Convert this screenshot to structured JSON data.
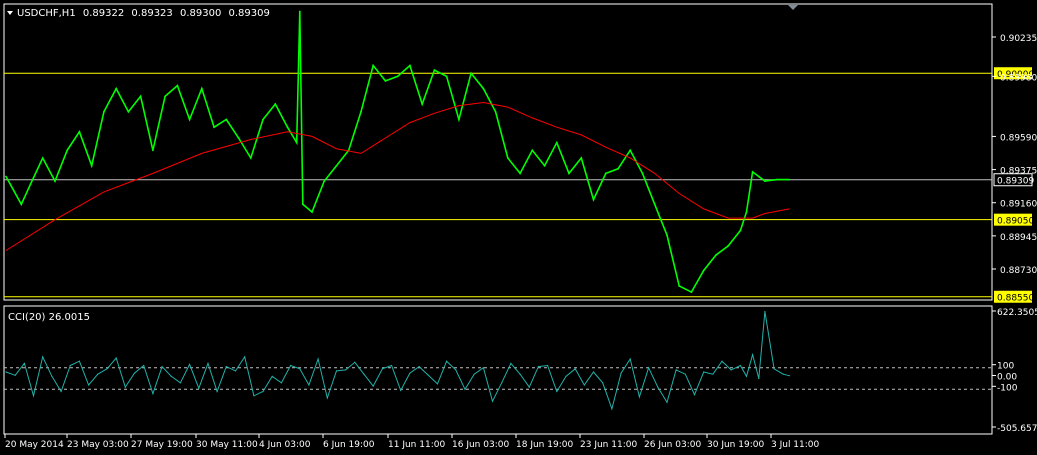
{
  "main_header": {
    "symbol": "USDCHF,H1",
    "open": "0.89322",
    "high": "0.89323",
    "low": "0.89300",
    "close": "0.89309"
  },
  "indicator_header": "CCI(20) 26.0015",
  "colors": {
    "background": "#000000",
    "frame": "#ffffff",
    "price_line": "#00ff00",
    "moving_average": "#ff0000",
    "level_line": "#ffff00",
    "level_label_bg": "#ffff00",
    "current_price_line": "#c0c0c0",
    "cci_line": "#20b2aa",
    "text": "#ffffff"
  },
  "chart_data": [
    {
      "type": "line",
      "title": "USDCHF,H1",
      "ylim": [
        0.8853,
        0.9042
      ],
      "y_ticks": [
        0.90235,
        0.8998,
        0.8959,
        0.89375,
        0.8916,
        0.88945,
        0.8873
      ],
      "y_tick_labels": [
        "0.90235",
        "0.89980",
        "0.89590",
        "0.89375",
        "0.89160",
        "0.88945",
        "0.88730"
      ],
      "x_ticks": [
        0,
        20,
        40,
        64,
        83,
        103,
        123,
        145,
        163,
        182,
        200,
        220,
        240,
        257
      ],
      "x_tick_labels": [
        "20 May 2014",
        "23 May 03:00",
        "27 May 19:00",
        "30 May 11:00",
        "4 Jun 03:00",
        "6 Jun 19:00",
        "11 Jun 11:00",
        "16 Jun 03:00",
        "18 Jun 19:00",
        "23 Jun 11:00",
        "26 Jun 03:00",
        "30 Jun 19:00",
        "3 Jul 11:00",
        ""
      ],
      "horizontal_levels": [
        {
          "value": 0.9,
          "label": "0.90000"
        },
        {
          "value": 0.8905,
          "label": "0.89050"
        },
        {
          "value": 0.8855,
          "label": "0.88550"
        }
      ],
      "current_price": {
        "value": 0.89309,
        "label": "0.89309"
      },
      "series": [
        {
          "name": "",
          "role": "close",
          "x": [
            0,
            5,
            8,
            12,
            16,
            20,
            24,
            28,
            32,
            36,
            40,
            44,
            48,
            52,
            56,
            60,
            64,
            68,
            72,
            76,
            80,
            84,
            88,
            92,
            95,
            96,
            97,
            100,
            104,
            108,
            112,
            116,
            120,
            124,
            128,
            132,
            136,
            140,
            144,
            148,
            152,
            156,
            160,
            164,
            168,
            172,
            176,
            180,
            184,
            188,
            192,
            196,
            200,
            204,
            208,
            212,
            216,
            220,
            224,
            228,
            232,
            236,
            240,
            242,
            244,
            246,
            248,
            252,
            256
          ],
          "values": [
            0.8933,
            0.8915,
            0.8928,
            0.8945,
            0.893,
            0.895,
            0.8962,
            0.894,
            0.8975,
            0.899,
            0.8975,
            0.8985,
            0.895,
            0.8985,
            0.8992,
            0.897,
            0.899,
            0.8965,
            0.897,
            0.8958,
            0.8945,
            0.897,
            0.898,
            0.8965,
            0.8955,
            0.904,
            0.8915,
            0.891,
            0.893,
            0.894,
            0.895,
            0.8975,
            0.9005,
            0.8995,
            0.8998,
            0.9005,
            0.898,
            0.9002,
            0.8998,
            0.897,
            0.9,
            0.899,
            0.8975,
            0.8945,
            0.8935,
            0.895,
            0.894,
            0.8955,
            0.8935,
            0.8945,
            0.8918,
            0.8935,
            0.8938,
            0.895,
            0.8935,
            0.8915,
            0.8895,
            0.8862,
            0.8858,
            0.8872,
            0.8882,
            0.8888,
            0.8898,
            0.891,
            0.8936,
            0.8933,
            0.893,
            0.8931,
            0.8931
          ]
        },
        {
          "name": "",
          "role": "moving-average",
          "x": [
            0,
            16,
            32,
            48,
            64,
            80,
            92,
            100,
            108,
            116,
            124,
            132,
            140,
            148,
            156,
            164,
            172,
            180,
            188,
            196,
            204,
            212,
            220,
            228,
            236,
            244,
            248,
            256
          ],
          "values": [
            0.8885,
            0.8905,
            0.8923,
            0.8935,
            0.8948,
            0.8957,
            0.8962,
            0.8959,
            0.8951,
            0.8948,
            0.8958,
            0.8968,
            0.8974,
            0.8979,
            0.8981,
            0.8978,
            0.8971,
            0.8965,
            0.896,
            0.8952,
            0.8945,
            0.8935,
            0.8922,
            0.8912,
            0.8906,
            0.8906,
            0.8909,
            0.8912
          ]
        }
      ]
    },
    {
      "type": "line",
      "title": "CCI(20) 26.0015",
      "ylim": [
        -505.6573,
        622.3505
      ],
      "y_ticks": [
        622.3505,
        100,
        0,
        -100,
        -505.6573
      ],
      "y_tick_labels": [
        "622.3505",
        "100",
        "0.00",
        "-100",
        "-505.6573"
      ],
      "reference_levels": [
        100,
        -100
      ],
      "series": [
        {
          "name": "",
          "x": [
            0,
            3,
            6,
            9,
            12,
            15,
            18,
            21,
            24,
            27,
            30,
            33,
            36,
            39,
            42,
            45,
            48,
            51,
            54,
            57,
            60,
            63,
            66,
            69,
            72,
            75,
            78,
            81,
            84,
            87,
            90,
            93,
            96,
            99,
            102,
            105,
            108,
            111,
            114,
            117,
            120,
            123,
            126,
            129,
            132,
            135,
            138,
            141,
            144,
            147,
            150,
            153,
            156,
            159,
            162,
            165,
            168,
            171,
            174,
            177,
            180,
            183,
            186,
            189,
            192,
            195,
            198,
            201,
            204,
            207,
            210,
            213,
            216,
            219,
            222,
            225,
            228,
            231,
            234,
            237,
            240,
            242,
            244,
            246,
            248,
            251,
            254,
            256
          ],
          "values": [
            60,
            30,
            140,
            -160,
            200,
            20,
            -120,
            120,
            160,
            -60,
            40,
            90,
            190,
            -80,
            50,
            120,
            -140,
            110,
            20,
            -40,
            130,
            -90,
            140,
            -120,
            110,
            70,
            200,
            -160,
            -120,
            20,
            -40,
            120,
            90,
            -60,
            180,
            -180,
            70,
            80,
            150,
            40,
            -70,
            90,
            120,
            -110,
            50,
            110,
            30,
            -50,
            160,
            80,
            -100,
            40,
            100,
            -210,
            -40,
            140,
            40,
            -80,
            110,
            120,
            -120,
            20,
            90,
            -60,
            60,
            -40,
            -280,
            50,
            180,
            -170,
            100,
            -80,
            -220,
            80,
            40,
            -150,
            60,
            40,
            160,
            80,
            120,
            20,
            220,
            0,
            620,
            90,
            40,
            26
          ]
        }
      ]
    }
  ]
}
